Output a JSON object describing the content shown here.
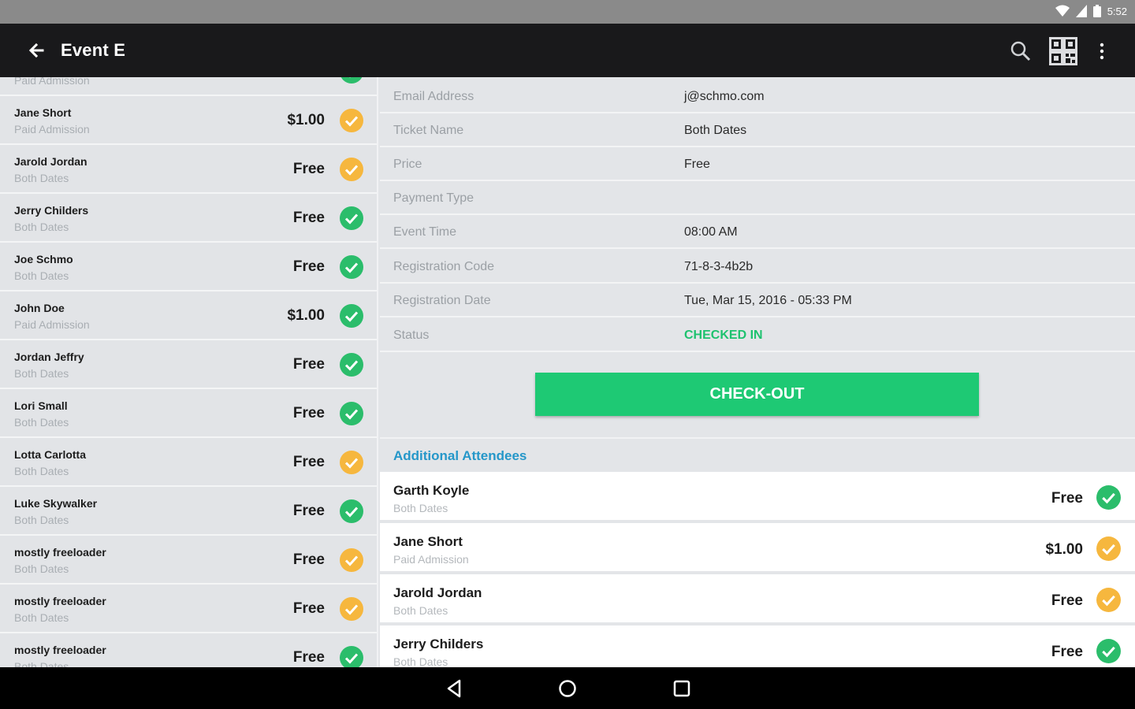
{
  "status_bar": {
    "time": "5:52",
    "icons": [
      "wifi-icon",
      "signal-icon",
      "battery-icon"
    ]
  },
  "toolbar": {
    "title": "Event E",
    "icons": [
      "back-arrow-icon",
      "search-icon",
      "qr-code-icon",
      "more-vert-icon"
    ]
  },
  "colors": {
    "toolbar_bg": "#19191b",
    "status_bar_bg": "#8a8a8a",
    "check_green": "#2bbd6b",
    "check_orange": "#f6b73e",
    "checked_in_text": "#1ec26f",
    "checkout_button": "#1ec974",
    "section_header": "#2597c9"
  },
  "attendee_list": {
    "partial_top": {
      "sub": "Paid Admission",
      "status": "green"
    },
    "items": [
      {
        "name": "Jane Short",
        "sub": "Paid Admission",
        "price": "$1.00",
        "status": "orange"
      },
      {
        "name": "Jarold Jordan",
        "sub": "Both Dates",
        "price": "Free",
        "status": "orange"
      },
      {
        "name": "Jerry Childers",
        "sub": "Both Dates",
        "price": "Free",
        "status": "green"
      },
      {
        "name": "Joe Schmo",
        "sub": "Both Dates",
        "price": "Free",
        "status": "green"
      },
      {
        "name": "John Doe",
        "sub": "Paid Admission",
        "price": "$1.00",
        "status": "green"
      },
      {
        "name": "Jordan Jeffry",
        "sub": "Both Dates",
        "price": "Free",
        "status": "green"
      },
      {
        "name": "Lori Small",
        "sub": "Both Dates",
        "price": "Free",
        "status": "green"
      },
      {
        "name": "Lotta Carlotta",
        "sub": "Both Dates",
        "price": "Free",
        "status": "orange"
      },
      {
        "name": "Luke Skywalker",
        "sub": "Both Dates",
        "price": "Free",
        "status": "green"
      },
      {
        "name": "mostly freeloader",
        "sub": "Both Dates",
        "price": "Free",
        "status": "orange"
      },
      {
        "name": "mostly freeloader",
        "sub": "Both Dates",
        "price": "Free",
        "status": "orange"
      },
      {
        "name": "mostly freeloader",
        "sub": "Both Dates",
        "price": "Free",
        "status": "green"
      }
    ]
  },
  "details": {
    "rows": [
      {
        "label": "Email Address",
        "value": "j@schmo.com"
      },
      {
        "label": "Ticket Name",
        "value": "Both Dates"
      },
      {
        "label": "Price",
        "value": "Free"
      },
      {
        "label": "Payment Type",
        "value": ""
      },
      {
        "label": "Event Time",
        "value": "08:00 AM"
      },
      {
        "label": "Registration Code",
        "value": "71-8-3-4b2b"
      },
      {
        "label": "Registration Date",
        "value": "Tue, Mar 15, 2016 - 05:33 PM"
      },
      {
        "label": "Status",
        "value": "CHECKED IN"
      }
    ],
    "checkout_label": "CHECK-OUT"
  },
  "additional_attendees": {
    "header": "Additional Attendees",
    "items": [
      {
        "name": "Garth Koyle",
        "sub": "Both Dates",
        "price": "Free",
        "status": "green"
      },
      {
        "name": "Jane Short",
        "sub": "Paid Admission",
        "price": "$1.00",
        "status": "orange"
      },
      {
        "name": "Jarold Jordan",
        "sub": "Both Dates",
        "price": "Free",
        "status": "orange"
      },
      {
        "name": "Jerry Childers",
        "sub": "Both Dates",
        "price": "Free",
        "status": "green"
      }
    ]
  },
  "nav_bar": {
    "icons": [
      "back-triangle-icon",
      "home-circle-icon",
      "recents-square-icon"
    ]
  }
}
